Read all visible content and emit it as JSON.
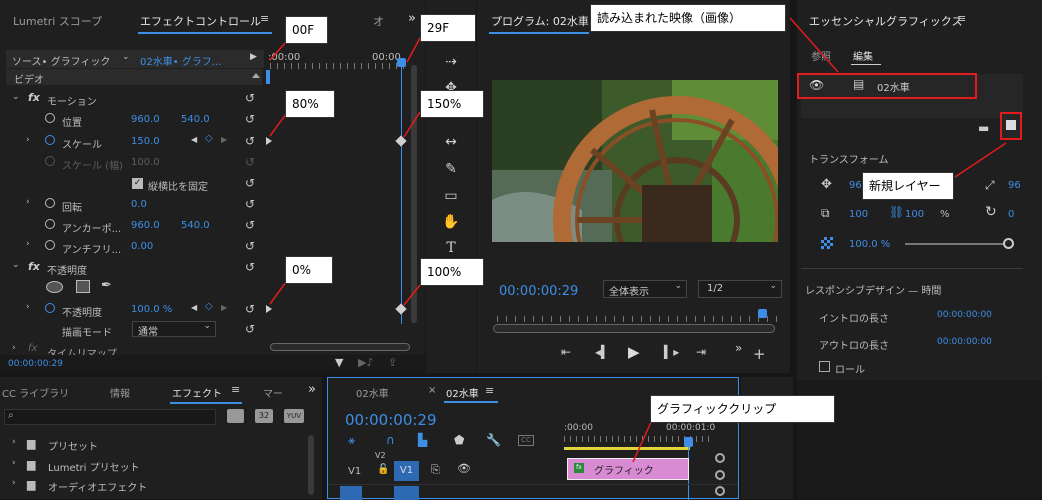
{
  "panels": {
    "left_tabs": [
      "Lumetri スコープ",
      "エフェクトコントロール",
      "オ"
    ],
    "program_title": "プログラム: 02水車",
    "essential_title": "エッセンシャルグラフィックス"
  },
  "effect_controls": {
    "source": "ソース• グラフィック",
    "clip": "02水車• グラフ...",
    "ruler_start": ":00:00",
    "ruler_end": "00:00",
    "video": "ビデオ",
    "motion": "モーション",
    "props": [
      {
        "name": "位置",
        "v1": "960.0",
        "v2": "540.0"
      },
      {
        "name": "スケール",
        "v1": "150.0",
        "v2": ""
      },
      {
        "name": "スケール (幅)",
        "v1": "100.0",
        "v2": ""
      },
      {
        "name": "縦横比を固定",
        "v1": "",
        "v2": ""
      },
      {
        "name": "回転",
        "v1": "0.0",
        "v2": ""
      },
      {
        "name": "アンカーポ...",
        "v1": "960.0",
        "v2": "540.0"
      },
      {
        "name": "アンチフリ...",
        "v1": "0.00",
        "v2": ""
      }
    ],
    "opacity_group": "不透明度",
    "opacity_name": "不透明度",
    "opacity_value": "100.0 %",
    "blend_label": "描画モード",
    "blend_value": "通常",
    "time_remap": "タイムリマップ",
    "timecode": "00:00:00:29"
  },
  "program": {
    "timecode": "00:00:00:29",
    "zoom": "全体表示",
    "quality": "1/2"
  },
  "essential": {
    "tab_browse": "参照",
    "tab_edit": "編集",
    "layer_name": "02水車",
    "transform_title": "トランスフォーム",
    "pos_x": "96",
    "pos_y": "96",
    "scale_w": "100",
    "scale_h": "100",
    "pct": "%",
    "rotation": "0",
    "opacity": "100.0 %",
    "responsive_title": "レスポンシブデザイン — 時間",
    "intro_label": "イントロの長さ",
    "intro_value": "00:00:00:00",
    "outro_label": "アウトロの長さ",
    "outro_value": "00:00:00:00",
    "roll_label": "ロール"
  },
  "bottom_left": {
    "tabs": [
      "CC ライブラリ",
      "情報",
      "エフェクト",
      "マー"
    ],
    "badges": [
      "32",
      "YUV"
    ],
    "items": [
      "プリセット",
      "Lumetri プリセット",
      "オーディオエフェクト"
    ]
  },
  "timeline": {
    "tab1": "02水車",
    "tab2": "02水車",
    "timecode": "00:00:00:29",
    "ruler_start": ":00:00",
    "ruler_end": "00:00:01:0",
    "v2": "V2",
    "v1": "V1",
    "clip_label": "グラフィック"
  },
  "annotations": {
    "f00": "00F",
    "f29": "29F",
    "s80": "80%",
    "s150": "150%",
    "o0": "0%",
    "o100": "100%",
    "media": "読み込まれた映像（画像）",
    "newlayer": "新規レイヤー",
    "graphic_clip": "グラフィッククリップ"
  }
}
